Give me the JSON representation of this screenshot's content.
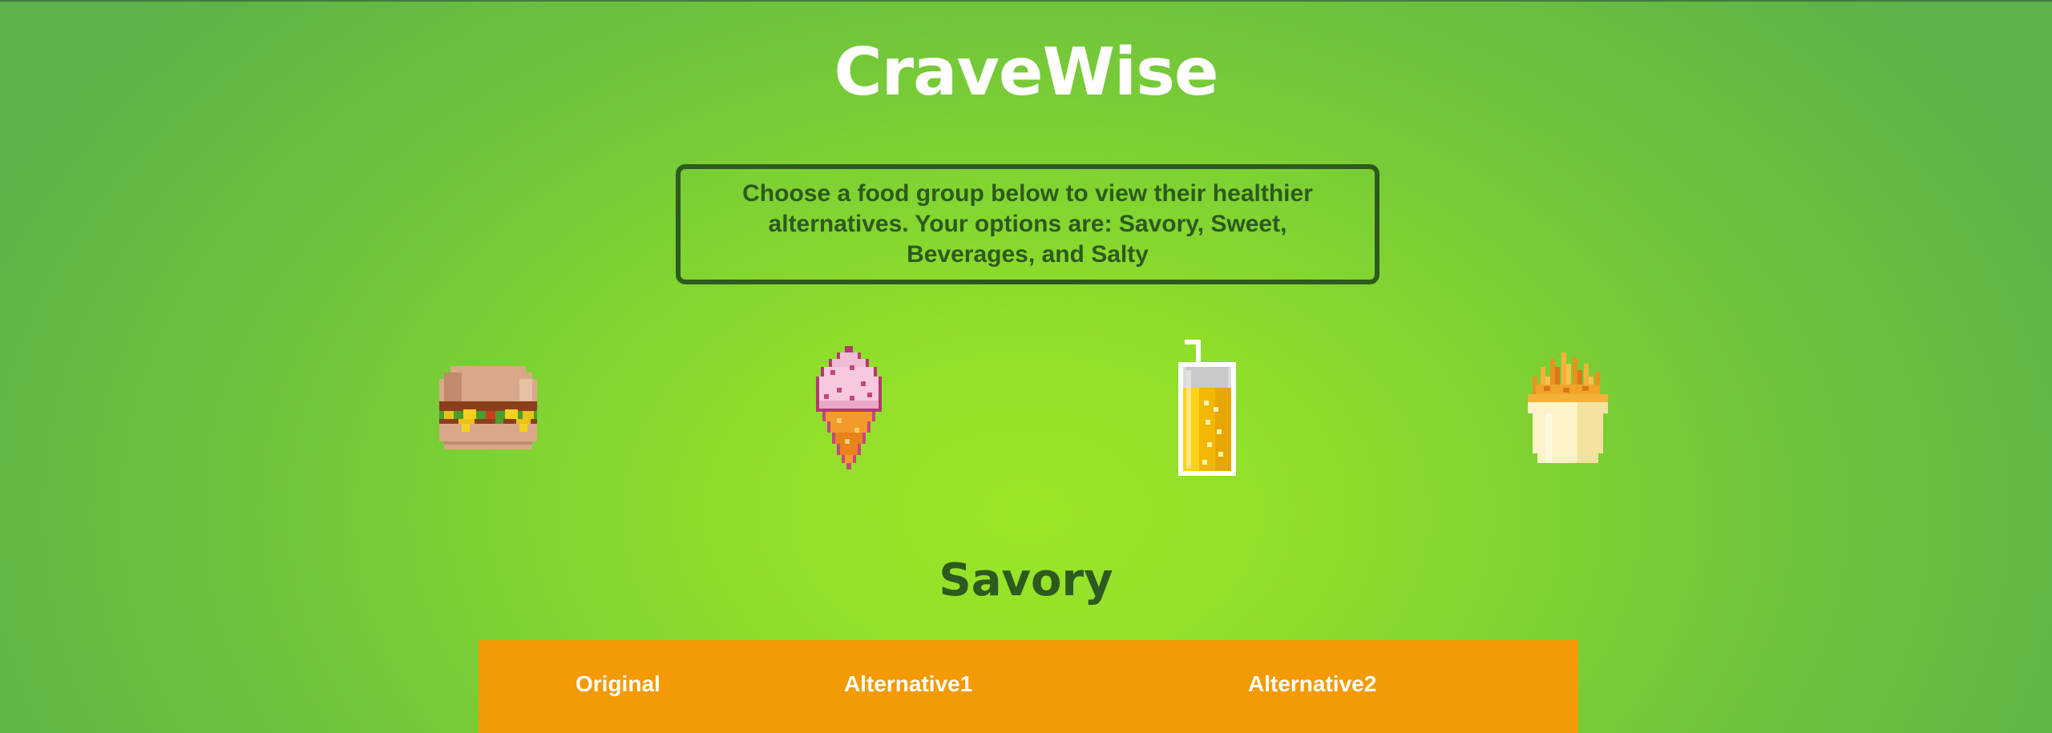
{
  "app": {
    "title": "CraveWise"
  },
  "intro": {
    "text": "Choose a food group below to view their healthier alternatives. Your options are: Savory, Sweet, Beverages, and Salty"
  },
  "food_groups": [
    {
      "name": "Savory",
      "icon": "burger-icon"
    },
    {
      "name": "Sweet",
      "icon": "ice-cream-icon"
    },
    {
      "name": "Beverages",
      "icon": "juice-drink-icon"
    },
    {
      "name": "Salty",
      "icon": "fries-icon"
    }
  ],
  "section": {
    "title": "Savory"
  },
  "table": {
    "columns": [
      "Original",
      "Alternative1",
      "Alternative2"
    ],
    "header_color": "#f39a05"
  },
  "colors": {
    "background_center": "#9be628",
    "background_edge": "#5db148",
    "dark_green": "#2d5a1e",
    "accent_orange": "#f39a05"
  }
}
